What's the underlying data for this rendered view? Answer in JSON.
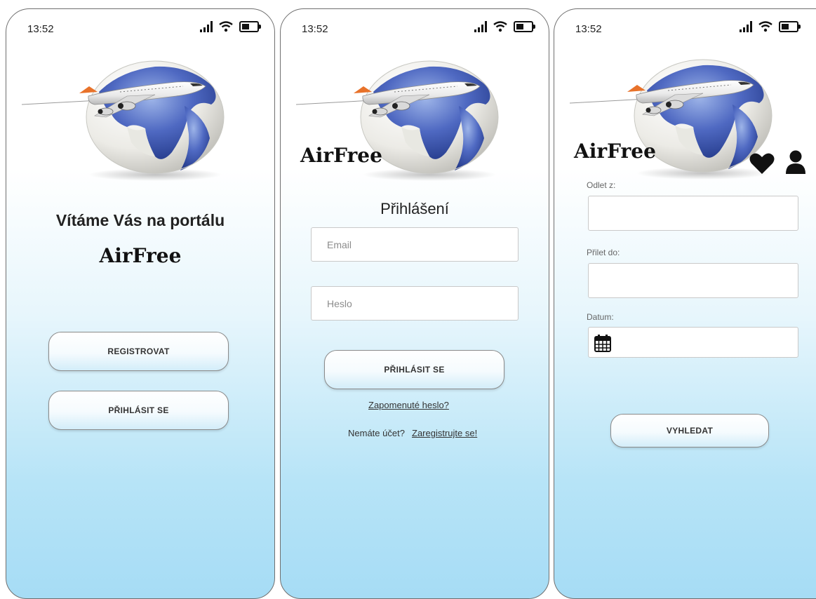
{
  "screens": {
    "welcome": {
      "status": {
        "time": "13:52"
      },
      "title_line1": "Vítáme Vás na portálu",
      "title_line2": "AirFree",
      "register_button": "REGISTROVAT",
      "login_button": "PŘIHLÁSIT SE"
    },
    "login": {
      "status": {
        "time": "13:52"
      },
      "brand": "AirFree",
      "heading": "Přihlášení",
      "email_placeholder": "Email",
      "password_placeholder": "Heslo",
      "login_button": "PŘIHLÁSIT SE",
      "forgot_link": "Zapomenuté heslo?",
      "no_account_text": "Nemáte účet?",
      "register_link": "Zaregistrujte se!"
    },
    "search": {
      "status": {
        "time": "13:52"
      },
      "brand": "AirFree",
      "from_label": "Odlet z:",
      "to_label": "Přilet do:",
      "date_label": "Datum:",
      "search_button": "VYHLEDAT"
    }
  },
  "icons": [
    "signal-icon",
    "wifi-icon",
    "battery-icon",
    "heart-icon",
    "user-icon",
    "calendar-icon"
  ],
  "colors": {
    "gradient_bottom": "#a6dcf5",
    "globe_ocean": "#3e58ad",
    "globe_land": "#f2f2ee",
    "button_border": "#8a8a8a"
  }
}
